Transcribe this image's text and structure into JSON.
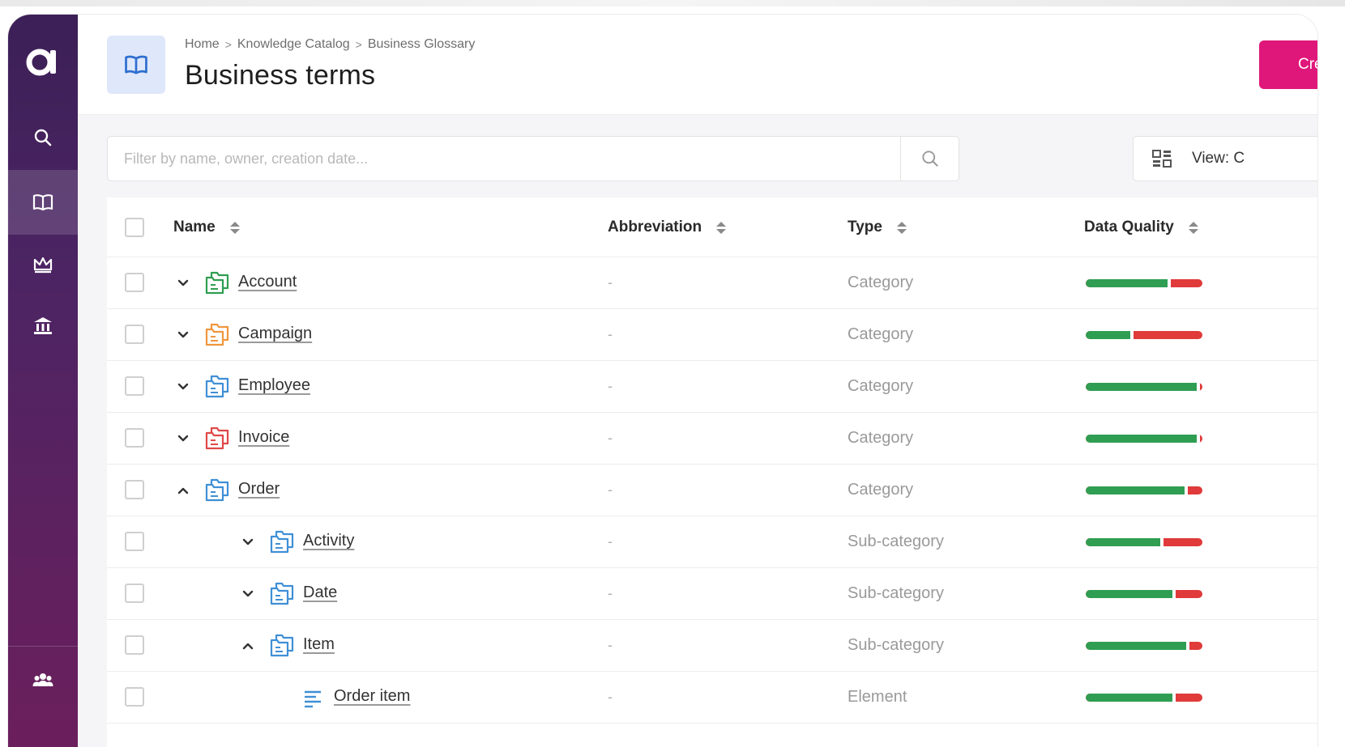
{
  "app": {
    "logo_text": "a"
  },
  "sidebar": {
    "items": [
      {
        "icon": "search-icon"
      },
      {
        "icon": "book-icon",
        "active": true
      },
      {
        "icon": "crown-icon"
      },
      {
        "icon": "bank-icon"
      },
      {
        "icon": "users-icon"
      }
    ]
  },
  "header": {
    "breadcrumb": [
      "Home",
      "Knowledge Catalog",
      "Business Glossary"
    ],
    "title": "Business terms",
    "create_label": "Cre"
  },
  "filter": {
    "placeholder": "Filter by name, owner, creation date..."
  },
  "view": {
    "label": "View: C"
  },
  "table": {
    "columns": {
      "name": "Name",
      "abbreviation": "Abbreviation",
      "type": "Type",
      "data_quality": "Data Quality"
    },
    "rows": [
      {
        "name": "Account",
        "abbreviation": "-",
        "type": "Category",
        "level": 0,
        "expand": "down",
        "icon": "folder-icon",
        "icon_color": "#2f9e52",
        "dq_good": 0.7
      },
      {
        "name": "Campaign",
        "abbreviation": "-",
        "type": "Category",
        "level": 0,
        "expand": "down",
        "icon": "folder-icon",
        "icon_color": "#f0963c",
        "dq_good": 0.38
      },
      {
        "name": "Employee",
        "abbreviation": "-",
        "type": "Category",
        "level": 0,
        "expand": "down",
        "icon": "folder-icon",
        "icon_color": "#3f8fd6",
        "dq_good": 0.95
      },
      {
        "name": "Invoice",
        "abbreviation": "-",
        "type": "Category",
        "level": 0,
        "expand": "down",
        "icon": "folder-icon",
        "icon_color": "#e04848",
        "dq_good": 0.95
      },
      {
        "name": "Order",
        "abbreviation": "-",
        "type": "Category",
        "level": 0,
        "expand": "up",
        "icon": "folder-icon",
        "icon_color": "#3f8fd6",
        "dq_good": 0.85
      },
      {
        "name": "Activity",
        "abbreviation": "-",
        "type": "Sub-category",
        "level": 1,
        "expand": "down",
        "icon": "folder-icon",
        "icon_color": "#3f8fd6",
        "dq_good": 0.64
      },
      {
        "name": "Date",
        "abbreviation": "-",
        "type": "Sub-category",
        "level": 1,
        "expand": "down",
        "icon": "folder-icon",
        "icon_color": "#3f8fd6",
        "dq_good": 0.74
      },
      {
        "name": "Item",
        "abbreviation": "-",
        "type": "Sub-category",
        "level": 1,
        "expand": "up",
        "icon": "folder-icon",
        "icon_color": "#3f8fd6",
        "dq_good": 0.86
      },
      {
        "name": "Order item",
        "abbreviation": "-",
        "type": "Element",
        "level": 2,
        "expand": "none",
        "icon": "element-icon",
        "icon_color": "#3f8fd6",
        "dq_good": 0.74
      }
    ]
  },
  "colors": {
    "accent": "#e0177a",
    "dq_good": "#2f9e52",
    "dq_bad": "#e03a3a",
    "sidebar_top": "#3c2057",
    "sidebar_bottom": "#6b1f5c"
  }
}
